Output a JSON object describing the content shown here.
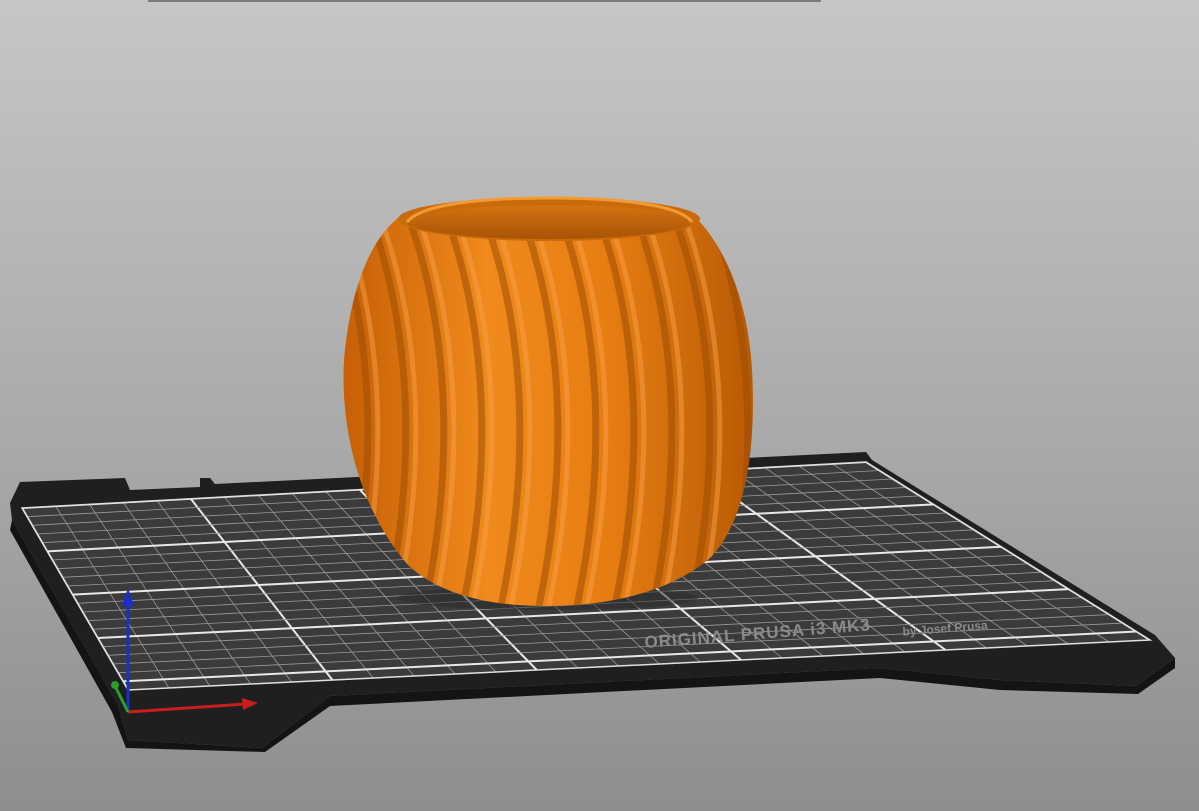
{
  "app": {
    "view": "3D editor view"
  },
  "bed": {
    "brand_line1": "ORIGINAL PRUSA i3  MK3",
    "brand_line2": "by Josef Prusa"
  },
  "object": {
    "shape": "twisted-vase",
    "color": "#e07b14"
  },
  "colors": {
    "background_top": "#c6c6c6",
    "background_bottom": "#8e8e8e",
    "bed_sheet": "#3a3a3a",
    "bed_frame": "#1e1e1e",
    "grid_line": "#d8d8d8",
    "axis_x": "#c81e1e",
    "axis_y": "#2aa02a",
    "axis_z": "#1a2fc8"
  },
  "icons": {
    "axes": "xyz-axes-icon"
  }
}
